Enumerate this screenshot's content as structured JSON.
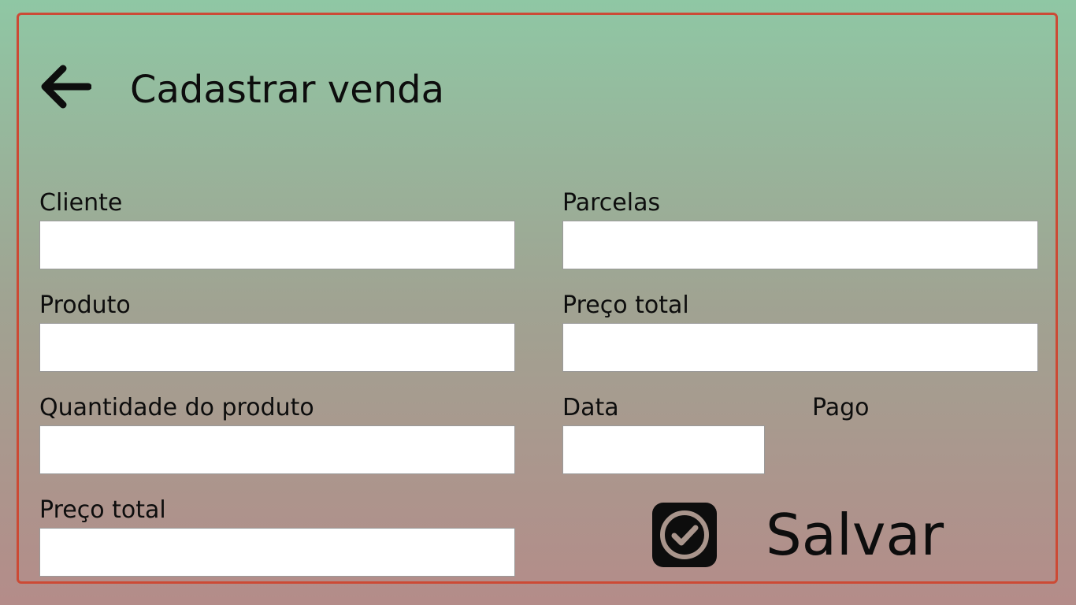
{
  "header": {
    "title": "Cadastrar venda",
    "back_icon": "arrow-left-icon"
  },
  "form": {
    "cliente": {
      "label": "Cliente",
      "value": ""
    },
    "parcelas": {
      "label": "Parcelas",
      "value": ""
    },
    "produto": {
      "label": "Produto",
      "value": ""
    },
    "preco_total_right": {
      "label": "Preço total",
      "value": ""
    },
    "quantidade": {
      "label": "Quantidade do produto",
      "value": ""
    },
    "data": {
      "label": "Data",
      "value": ""
    },
    "pago": {
      "label": "Pago"
    },
    "preco_total_left": {
      "label": "Preço total",
      "value": ""
    }
  },
  "actions": {
    "save_label": "Salvar",
    "save_icon": "check-box-icon"
  },
  "colors": {
    "frame_border": "#cc4a35",
    "gradient_top": "#8fc7a4",
    "gradient_bottom": "#b48c89",
    "input_background": "#ffffff"
  }
}
